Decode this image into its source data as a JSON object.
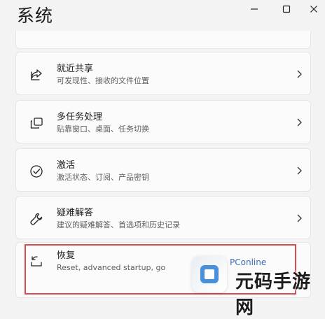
{
  "window": {
    "title": "系统"
  },
  "items": [
    {
      "title": "就近共享",
      "subtitle": "可发现性、接收的文件位置",
      "icon": "share-icon"
    },
    {
      "title": "多任务处理",
      "subtitle": "贴靠窗口、桌面、任务切换",
      "icon": "multitask-icon"
    },
    {
      "title": "激活",
      "subtitle": "激活状态、订阅、产品密钥",
      "icon": "activation-icon"
    },
    {
      "title": "疑难解答",
      "subtitle": "建议的疑难解答、首选项和历史记录",
      "icon": "wrench-icon"
    },
    {
      "title": "恢复",
      "subtitle": "Reset, advanced startup, go",
      "icon": "recovery-icon"
    }
  ],
  "watermark": {
    "brand": "PConline",
    "site": "元码手游网"
  },
  "colors": {
    "highlight": "#d94a4a",
    "background": "#f3f3f3",
    "card": "#fbfbfb"
  }
}
